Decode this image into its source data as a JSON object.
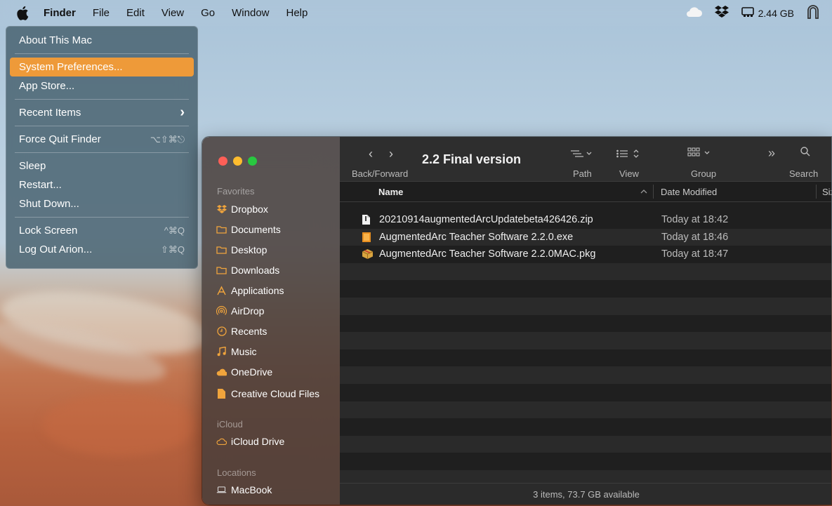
{
  "menubar": {
    "apple_icon": "apple-logo-icon",
    "app_name": "Finder",
    "menus": [
      "File",
      "Edit",
      "View",
      "Go",
      "Window",
      "Help"
    ],
    "status_items": {
      "cloud_icon": "cloud-icon",
      "dropbox_icon": "dropbox-icon",
      "storage_icon": "storage-icon",
      "storage_label": "2.44 GB",
      "user_icon": "user-icon"
    }
  },
  "apple_menu": {
    "items": [
      {
        "label": "About This Mac"
      },
      {
        "label": "System Preferences..."
      },
      {
        "label": "App Store..."
      },
      {
        "label": "Recent Items",
        "arrow": "›"
      },
      {
        "label": "Force Quit Finder",
        "shortcut": "⌥⇧⌘⎋"
      },
      {
        "label": "Sleep"
      },
      {
        "label": "Restart..."
      },
      {
        "label": "Shut Down..."
      },
      {
        "label": "Lock Screen",
        "shortcut": "^⌘Q"
      },
      {
        "label": "Log Out Arion...",
        "shortcut": "⇧⌘Q"
      }
    ],
    "highlighted_index": 1,
    "highlight_color": "#ee9a39"
  },
  "finder": {
    "sidebar": {
      "sections": [
        {
          "title": "Favorites"
        },
        {
          "title": "iCloud"
        },
        {
          "title": "Locations"
        }
      ],
      "favorites": [
        {
          "label": "Dropbox",
          "icon": "dropbox-icon"
        },
        {
          "label": "Documents",
          "icon": "folder-icon"
        },
        {
          "label": "Desktop",
          "icon": "folder-icon"
        },
        {
          "label": "Downloads",
          "icon": "folder-icon"
        },
        {
          "label": "Applications",
          "icon": "applications-icon"
        },
        {
          "label": "AirDrop",
          "icon": "airdrop-icon"
        },
        {
          "label": "Recents",
          "icon": "clock-icon"
        },
        {
          "label": "Music",
          "icon": "music-icon"
        },
        {
          "label": "OneDrive",
          "icon": "onedrive-icon"
        },
        {
          "label": "Creative Cloud Files",
          "icon": "document-icon"
        }
      ],
      "icloud": [
        {
          "label": "iCloud Drive",
          "icon": "cloud-icon"
        }
      ],
      "locations": [
        {
          "label": "MacBook",
          "icon": "laptop-icon"
        }
      ]
    },
    "toolbar": {
      "title": "2.2 Final version",
      "back_forward_label": "Back/Forward",
      "path_label": "Path",
      "view_label": "View",
      "group_label": "Group",
      "search_label": "Search"
    },
    "columns": {
      "name": "Name",
      "date_modified": "Date Modified",
      "size": "Size"
    },
    "files": [
      {
        "name": "20210914augmentedArcUpdatebeta426426.zip",
        "date": "Today at 18:42",
        "icon": "zip-file-icon"
      },
      {
        "name": "AugmentedArc Teacher Software 2.2.0.exe",
        "date": "Today at 18:46",
        "icon": "exe-file-icon"
      },
      {
        "name": "AugmentedArc Teacher Software 2.2.0MAC.pkg",
        "date": "Today at 18:47",
        "icon": "package-icon"
      }
    ],
    "status": "3 items, 73.7 GB available"
  }
}
